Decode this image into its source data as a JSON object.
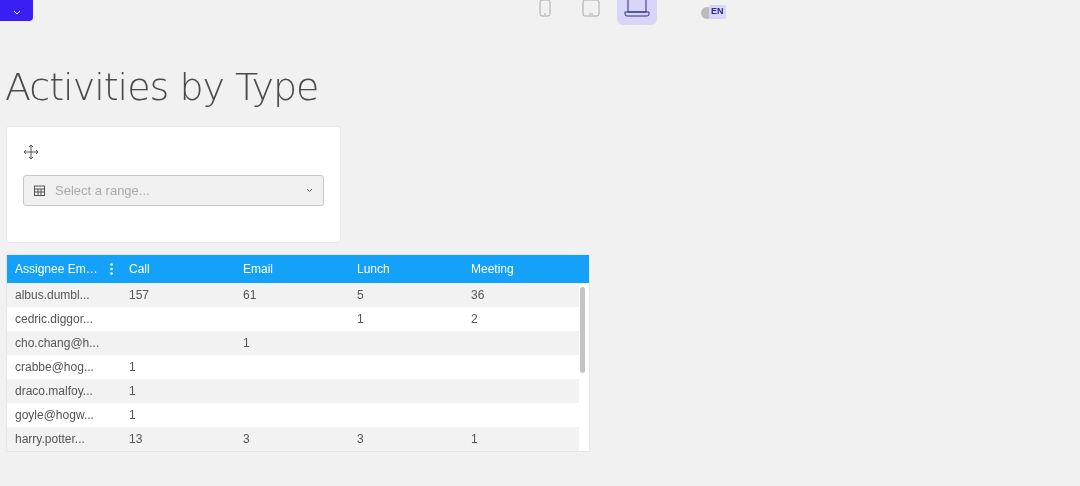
{
  "toolbar": {
    "devices": [
      {
        "kind": "phone",
        "selected": false
      },
      {
        "kind": "tablet",
        "selected": false
      },
      {
        "kind": "laptop",
        "selected": true
      }
    ],
    "language": "EN"
  },
  "title": "Activities by Type",
  "filter": {
    "placeholder": "Select a range..."
  },
  "table": {
    "columns": [
      "Assignee Em…",
      "Call",
      "Email",
      "Lunch",
      "Meeting"
    ],
    "rows": [
      [
        "albus.dumbl...",
        "157",
        "61",
        "5",
        "36"
      ],
      [
        "cedric.diggor...",
        "",
        "",
        "1",
        "2"
      ],
      [
        "cho.chang@h...",
        "",
        "1",
        "",
        ""
      ],
      [
        "crabbe@hog...",
        "1",
        "",
        "",
        ""
      ],
      [
        "draco.malfoy...",
        "1",
        "",
        "",
        ""
      ],
      [
        "goyle@hogw...",
        "1",
        "",
        "",
        ""
      ],
      [
        "harry.potter...",
        "13",
        "3",
        "3",
        "1"
      ]
    ]
  }
}
